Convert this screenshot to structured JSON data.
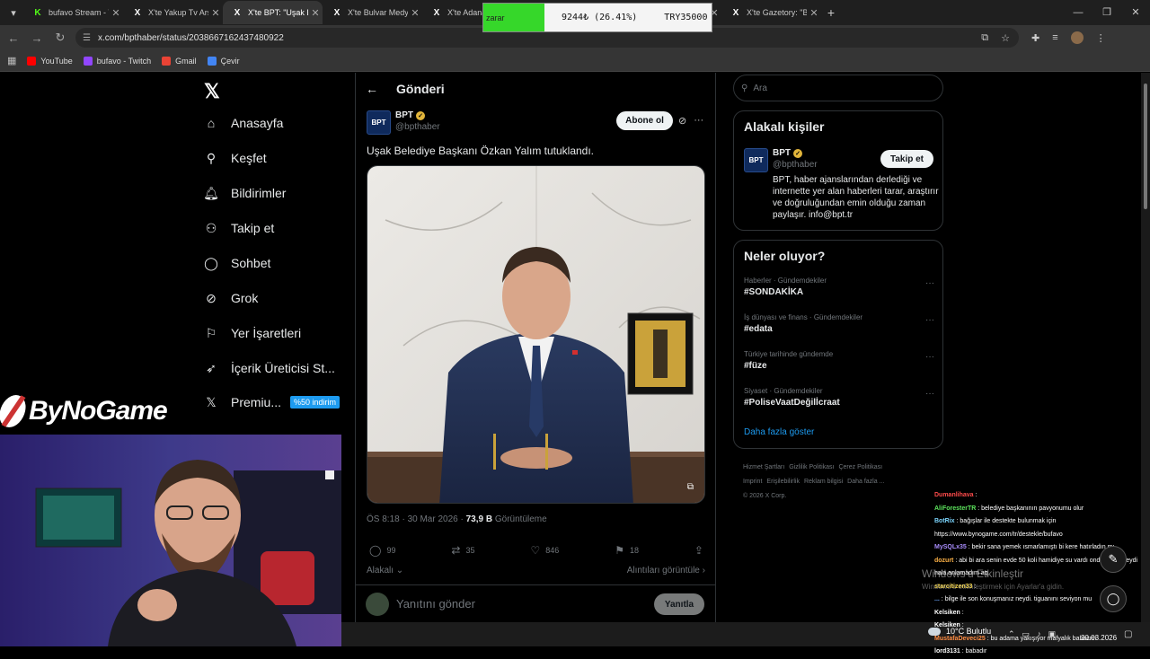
{
  "browser": {
    "tabs": [
      {
        "title": "bufavo Stream - V",
        "favicon": "K",
        "color": "#53fc18",
        "active": false
      },
      {
        "title": "X'te Yakup Tv Arş",
        "favicon": "X",
        "color": "#ffffff",
        "active": false
      },
      {
        "title": "X'te BPT: \"Uşak Be",
        "favicon": "X",
        "color": "#ffffff",
        "active": true
      },
      {
        "title": "X'te Bulvar Medya",
        "favicon": "X",
        "color": "#ffffff",
        "active": false
      },
      {
        "title": "X'te Adanacı",
        "favicon": "X",
        "color": "#ffffff",
        "active": false
      },
      {
        "title": "X",
        "favicon": "X",
        "color": "#ffffff",
        "active": false
      },
      {
        "title": "X",
        "favicon": "X",
        "color": "#ffffff",
        "active": false
      },
      {
        "title": "X'te Gazetory: \"Bi",
        "favicon": "X",
        "color": "#ffffff",
        "active": false
      }
    ],
    "url": "x.com/bpthaber/status/2038667162437480922",
    "bookmarks": [
      {
        "label": "YouTube",
        "color": "#ff0000",
        "icon": "play-icon"
      },
      {
        "label": "bufavo - Twitch",
        "color": "#9146ff",
        "icon": "twitch-icon"
      },
      {
        "label": "Gmail",
        "color": "#ea4335",
        "icon": "mail-icon"
      },
      {
        "label": "Çevir",
        "color": "#4285f4",
        "icon": "translate-icon"
      }
    ]
  },
  "stream_overlay": {
    "status": "zarar",
    "amount": "9244₺ (26.41%)",
    "target": "TRY35000",
    "brand": "ByNoGame"
  },
  "nav": {
    "items": [
      {
        "label": "Anasayfa",
        "icon": "home-icon"
      },
      {
        "label": "Keşfet",
        "icon": "search-icon"
      },
      {
        "label": "Bildirimler",
        "icon": "bell-icon"
      },
      {
        "label": "Takip et",
        "icon": "add-user-icon"
      },
      {
        "label": "Sohbet",
        "icon": "chat-icon"
      },
      {
        "label": "Grok",
        "icon": "grok-icon"
      },
      {
        "label": "Yer İşaretleri",
        "icon": "bookmark-icon"
      },
      {
        "label": "İçerik Üreticisi St...",
        "icon": "rocket-icon"
      },
      {
        "label": "Premiu...",
        "icon": "x-logo-icon"
      }
    ],
    "premium_badge": "%50 indirim"
  },
  "post": {
    "header": "Gönderi",
    "author_name": "BPT",
    "author_handle": "@bpthaber",
    "avatar_text": "BPT",
    "subscribe_label": "Abone ol",
    "text": "Uşak Belediye Başkanı Özkan Yalım tutuklandı.",
    "time": "ÖS 8:18 · 30 Mar 2026 ·",
    "views": "73,9 B",
    "views_label": "Görüntüleme",
    "replies": "99",
    "reposts": "35",
    "likes": "846",
    "bookmarks": "18",
    "related_label": "Alakalı",
    "quotes_label": "Alıntıları görüntüle",
    "reply_placeholder": "Yanıtını gönder",
    "reply_button": "Yanıtla"
  },
  "sidebar": {
    "search_placeholder": "Ara",
    "people_title": "Alakalı kişiler",
    "person": {
      "name": "BPT",
      "handle": "@bpthaber",
      "follow_label": "Takip et",
      "bio": "BPT, haber ajanslarından derlediği ve internette yer alan haberleri tarar, araştırır ve doğruluğundan emin olduğu zaman paylaşır. info@bpt.tr"
    },
    "trends_title": "Neler oluyor?",
    "trends": [
      {
        "category": "Haberler · Gündemdekiler",
        "tag": "#SONDAKİKA"
      },
      {
        "category": "İş dünyası ve finans · Gündemdekiler",
        "tag": "#edata"
      },
      {
        "category": "Türkiye tarihinde gündemde",
        "tag": "#füze"
      },
      {
        "category": "Siyaset · Gündemdekiler",
        "tag": "#PoliseVaatDeğilİcraat"
      }
    ],
    "show_more": "Daha fazla göster",
    "footer_links": [
      "Hizmet Şartları",
      "Gizlilik Politikası",
      "Çerez Politikası",
      "Imprint",
      "Erişilebilirlik",
      "Reklam bilgisi",
      "Daha fazla ..."
    ],
    "copyright": "© 2026 X Corp."
  },
  "chat": [
    {
      "user": "Dumanlihava",
      "color": "#ff4b4b",
      "message": ""
    },
    {
      "user": "AliForesterTR",
      "color": "#5de55d",
      "message": "belediye başkanının pavyonumu olur"
    },
    {
      "user": "BotRix",
      "color": "#7cd6ff",
      "message": "bağışlar ile destekte bulunmak için https://www.bynogame.com/tr/destekle/bufavo"
    },
    {
      "user": "MySQLx35",
      "color": "#a78bfa",
      "message": "bekir sana yemek ısmarlamıştı bi kere hatırladın mı"
    },
    {
      "user": "dozurt",
      "color": "#ffb347",
      "message": "abi bi ara senin evde 50 koli hamidiye su vardı onda amaç neydi hala anlamadım aq"
    },
    {
      "user": "starcitizen33",
      "color": "#f5d547",
      "message": ""
    },
    {
      "user": "...",
      "color": "#6ea8ff",
      "message": "bilge ile son konuşmanız neydi. tiguanını seviyon mu"
    },
    {
      "user": "Kelsiken",
      "color": "#ffffff",
      "message": ""
    },
    {
      "user": "Kelsiken",
      "color": "#ffffff",
      "message": ""
    },
    {
      "user": "MustafaDeveci25",
      "color": "#ff8c42",
      "message": "bu adama yakışıyor mafyalık babacım"
    },
    {
      "user": "lord3131",
      "color": "#ffffff",
      "message": "babadır"
    }
  ],
  "windows": {
    "watermark_title": "Windows'u Etkinleştir",
    "watermark_sub": "Windows'u etkinleştirmek için Ayarlar'a gidin.",
    "weather": "10°C  Bulutlu",
    "date": "30.03.2026"
  }
}
